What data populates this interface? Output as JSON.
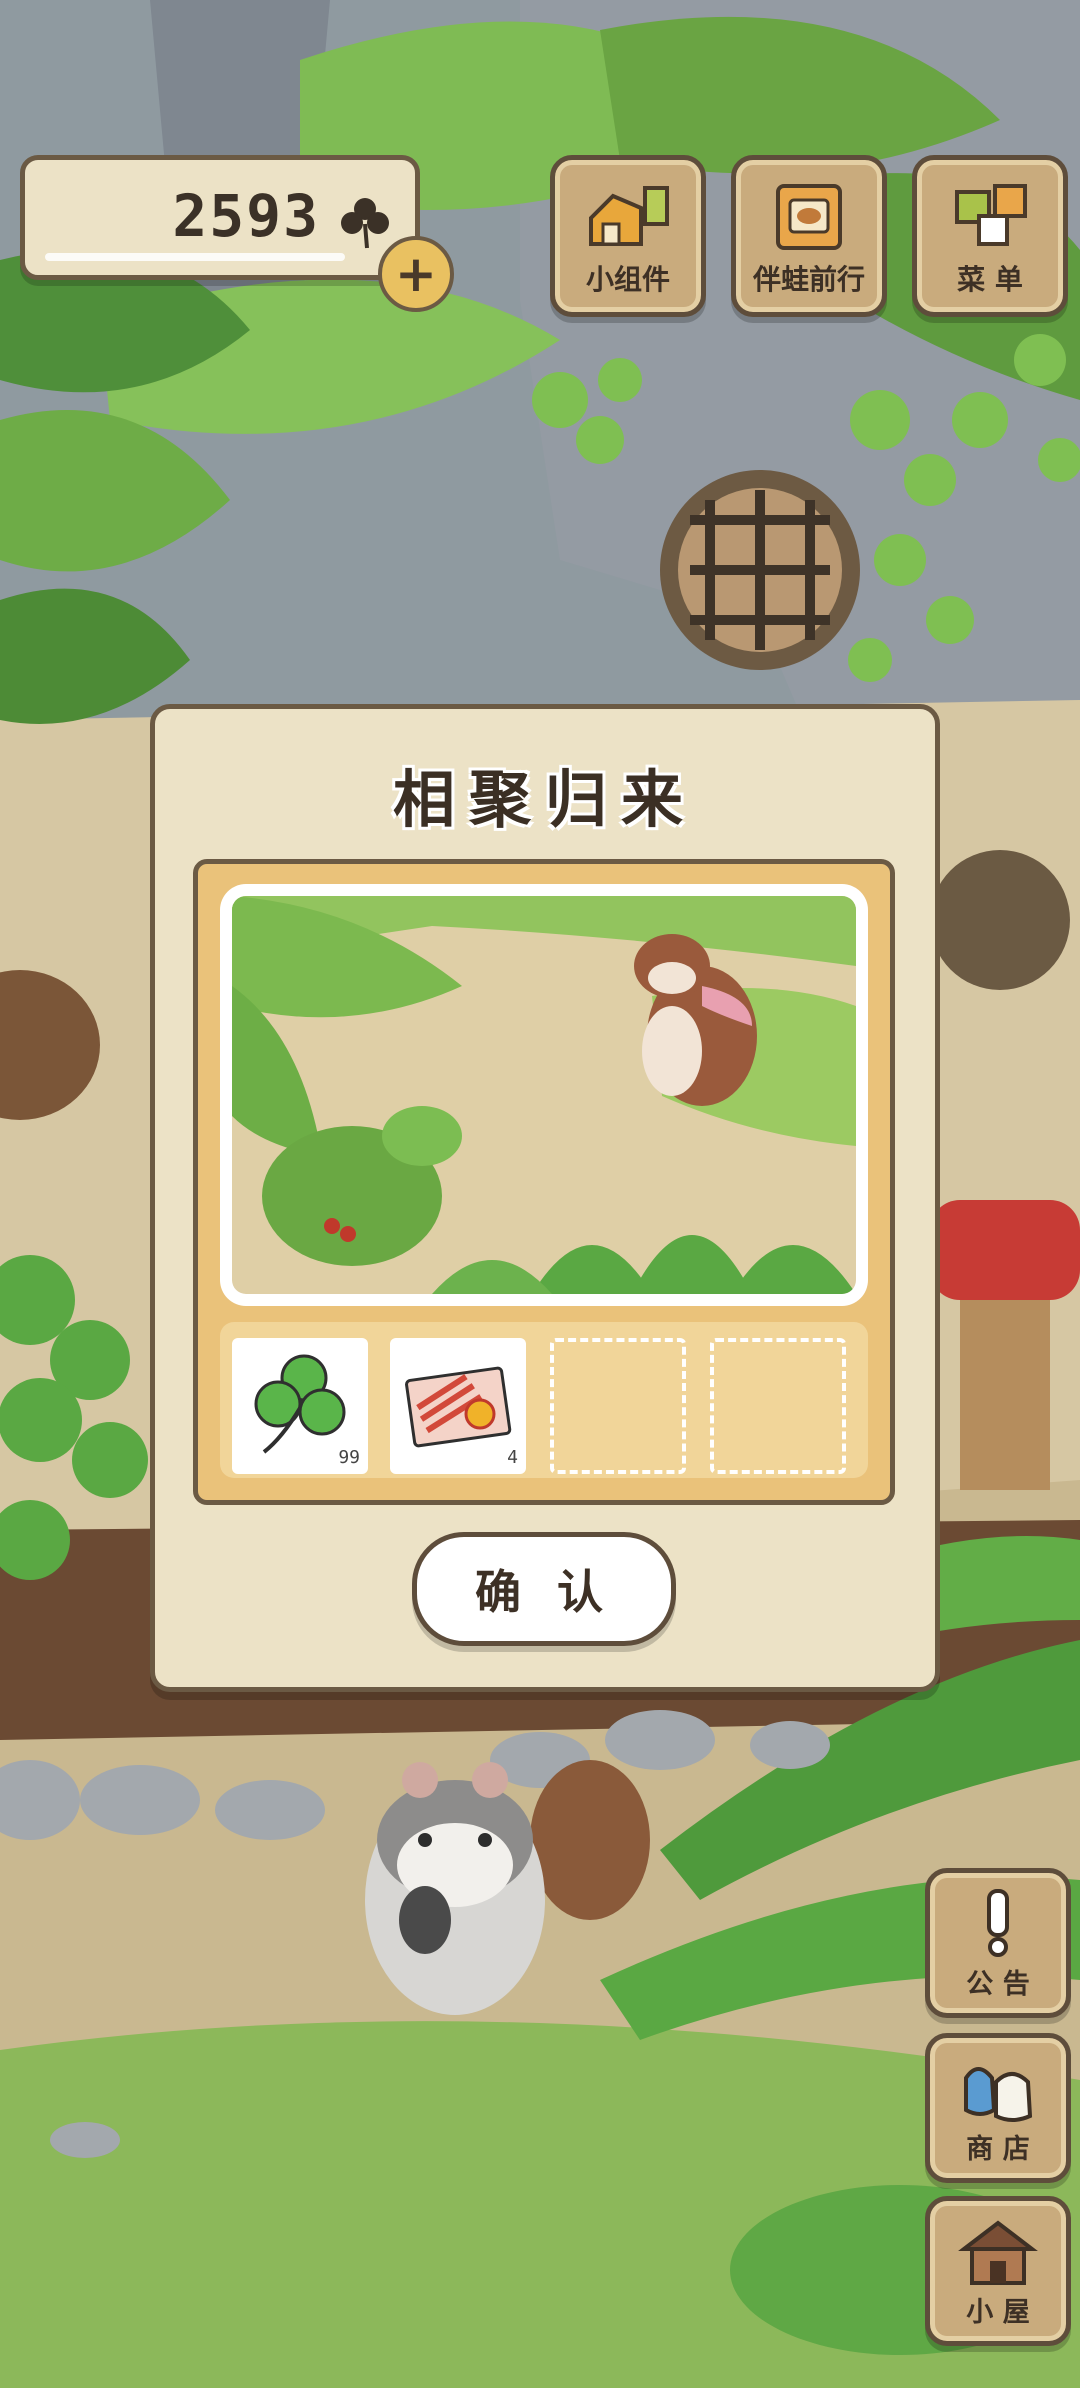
{
  "currency": {
    "amount": "2593",
    "icon": "clover-icon",
    "add_icon": "plus-icon"
  },
  "top_buttons": [
    {
      "label": "小组件",
      "icon": "widget-icon"
    },
    {
      "label": "伴蛙前行",
      "icon": "frog-journey-icon"
    },
    {
      "label": "菜 单",
      "icon": "menu-icon"
    }
  ],
  "side_buttons": [
    {
      "label": "公 告",
      "icon": "exclamation-icon"
    },
    {
      "label": "商 店",
      "icon": "shop-bag-icon"
    },
    {
      "label": "小 屋",
      "icon": "house-icon"
    }
  ],
  "dialog": {
    "title": "相聚归来",
    "items": [
      {
        "icon": "clover-icon",
        "quantity": "99"
      },
      {
        "icon": "lottery-ticket-icon",
        "quantity": "4"
      },
      {
        "icon": "empty-slot"
      },
      {
        "icon": "empty-slot"
      }
    ],
    "confirm_label": "确 认"
  },
  "colors": {
    "panel": "#ece2c6",
    "border": "#6b5a44",
    "card": "#eac27a",
    "button": "#c9ab7d"
  }
}
